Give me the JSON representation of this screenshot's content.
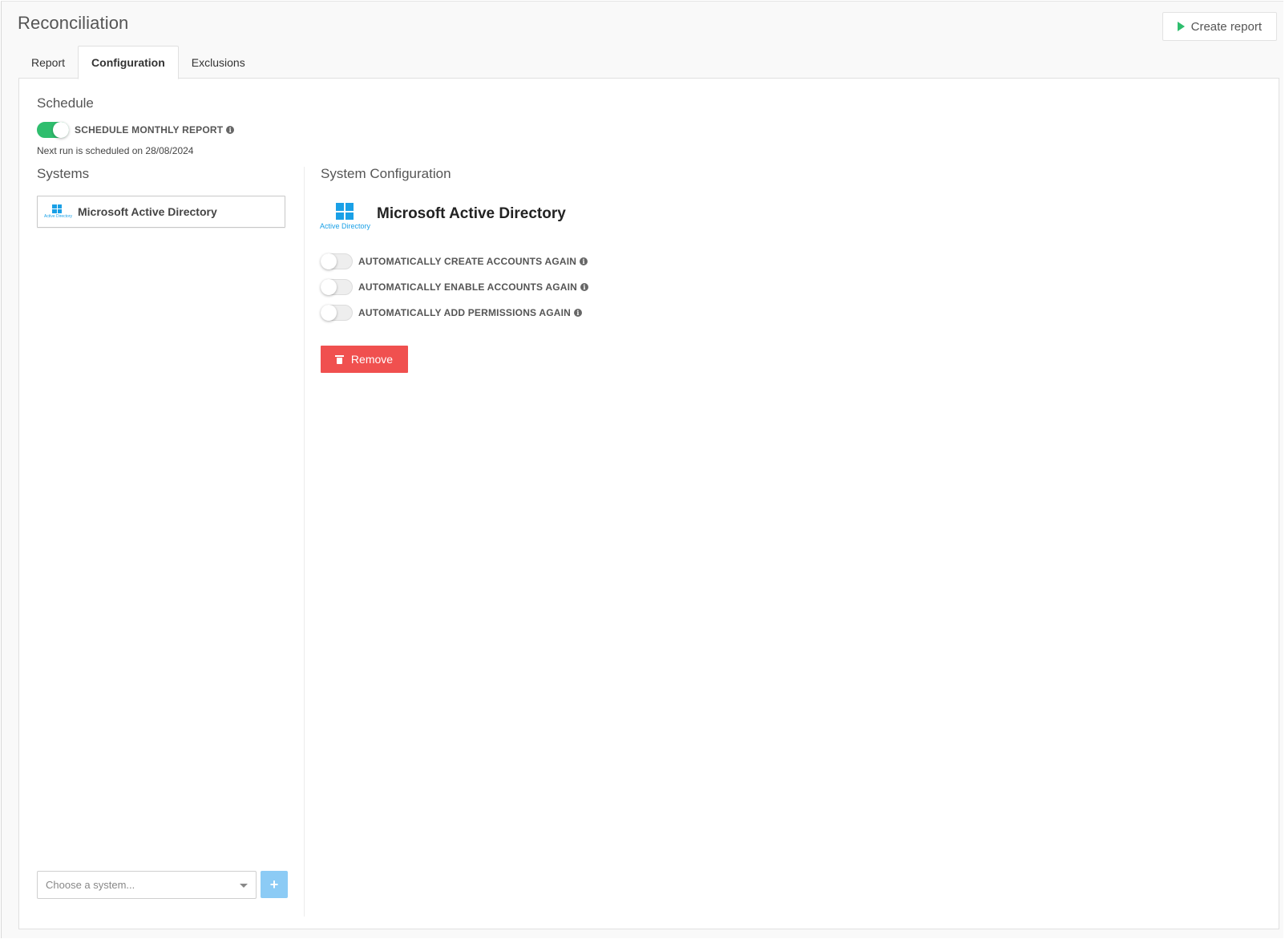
{
  "page": {
    "title": "Reconciliation"
  },
  "header": {
    "create_report_label": "Create report"
  },
  "tabs": [
    {
      "label": "Report",
      "active": false
    },
    {
      "label": "Configuration",
      "active": true
    },
    {
      "label": "Exclusions",
      "active": false
    }
  ],
  "schedule": {
    "title": "Schedule",
    "toggle_label": "SCHEDULE MONTHLY REPORT",
    "toggle_on": true,
    "next_run": "Next run is scheduled on 28/08/2024"
  },
  "systems": {
    "title": "Systems",
    "items": [
      {
        "label": "Microsoft Active Directory",
        "logo_caption": "Active Directory"
      }
    ],
    "select_placeholder": "Choose a system...",
    "add_label": "+"
  },
  "system_config": {
    "title": "System Configuration",
    "system_name": "Microsoft Active Directory",
    "logo_caption": "Active Directory",
    "options": [
      {
        "label": "AUTOMATICALLY CREATE ACCOUNTS AGAIN",
        "on": false
      },
      {
        "label": "AUTOMATICALLY ENABLE ACCOUNTS AGAIN",
        "on": false
      },
      {
        "label": "AUTOMATICALLY ADD PERMISSIONS AGAIN",
        "on": false
      }
    ],
    "remove_label": "Remove"
  },
  "colors": {
    "accent_green": "#2fbe6e",
    "danger_red": "#f0504f",
    "add_blue": "#8ccbf5",
    "windows_blue": "#1aa0e6"
  },
  "icons": {
    "create_report": "play-icon",
    "info": "info-icon",
    "remove": "trash-icon",
    "select": "chevron-down-icon",
    "add": "plus-icon",
    "system_logo": "windows-logo-icon"
  }
}
